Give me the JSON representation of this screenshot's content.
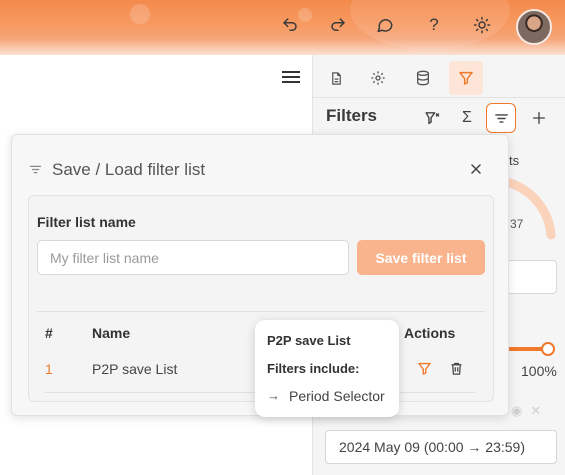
{
  "toolbar": {
    "icons": [
      "undo-icon",
      "redo-icon",
      "chat-icon",
      "help-icon",
      "theme-icon"
    ],
    "help_glyph": "?"
  },
  "side_panel": {
    "tabs": [
      "document-icon",
      "settings-icon",
      "database-icon",
      "filter-icon"
    ],
    "active_tab": "filter-icon",
    "title": "Filters",
    "header_actions": [
      "clear-filter-icon",
      "sum-icon",
      "sort-list-icon",
      "add-icon"
    ],
    "selected_action": "sort-list-icon",
    "background": {
      "label_fragment": "ts",
      "gauge_value": "37",
      "slider_value": 1.0,
      "percent_label": "100%",
      "date_range": "2024 May 09 (00:00 → 23:59)"
    }
  },
  "dialog": {
    "title": "Save / Load filter list",
    "filter_list_name_label": "Filter list name",
    "input_value": "",
    "input_placeholder": "My filter list name",
    "save_button_label": "Save filter list",
    "table": {
      "columns": [
        "#",
        "Name",
        "Actions"
      ],
      "rows": [
        {
          "index": "1",
          "name": "P2P save List"
        }
      ]
    }
  },
  "tooltip": {
    "title": "P2P save List",
    "subtitle": "Filters include:",
    "arrow": "→",
    "items": [
      "Period Selector"
    ]
  },
  "colors": {
    "accent": "#f0792b",
    "save_button": "#f9b48e",
    "header_gradient_start": "#f48a4c"
  }
}
